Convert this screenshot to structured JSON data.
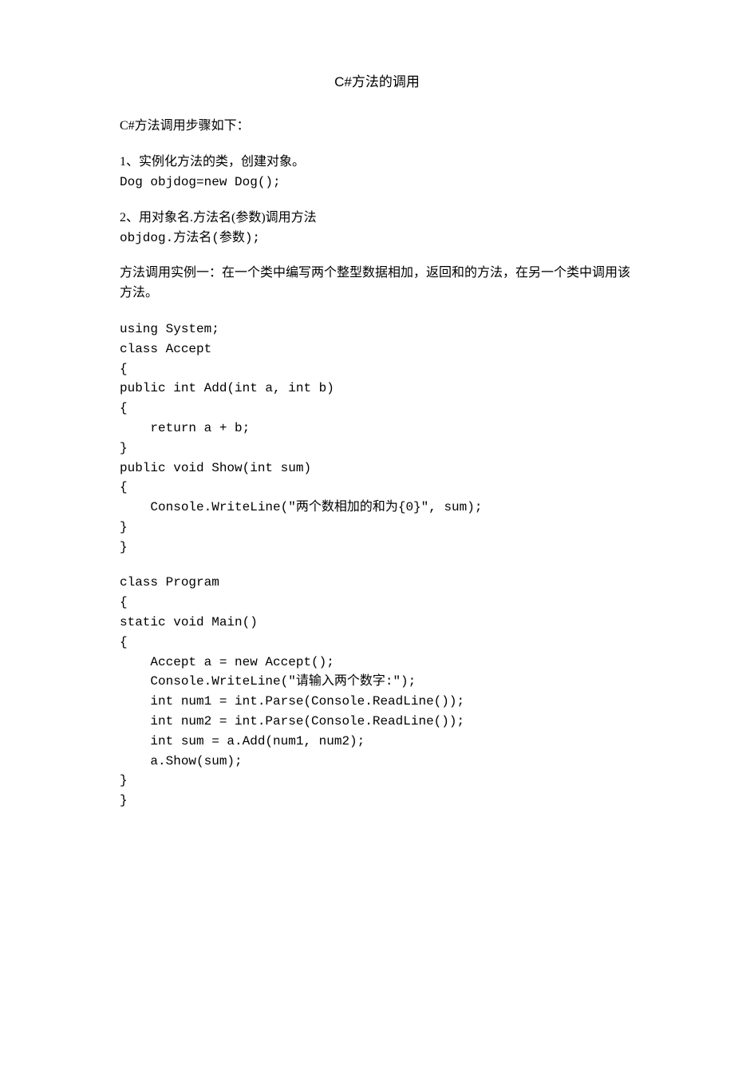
{
  "title": "C#方法的调用",
  "intro": "C#方法调用步骤如下：",
  "step1": {
    "text": "1、实例化方法的类，创建对象。",
    "code": "Dog objdog=new Dog();"
  },
  "step2": {
    "text": "2、用对象名.方法名(参数)调用方法",
    "code": "objdog.方法名(参数);"
  },
  "example_intro": "方法调用实例一：在一个类中编写两个整型数据相加，返回和的方法，在另一个类中调用该方法。",
  "code_block1": {
    "l1": "using System;",
    "l2": "class Accept",
    "l3": "{",
    "l4": "public int Add(int a, int b)",
    "l5": "{",
    "l6": "    return a + b;",
    "l7": "}",
    "l8": "public void Show(int sum)",
    "l9": "{",
    "l10": "    Console.WriteLine(\"两个数相加的和为{0}\", sum);",
    "l11": "}",
    "l12": "}"
  },
  "code_block2": {
    "l1": "class Program",
    "l2": "{",
    "l3": "static void Main()",
    "l4": "{",
    "l5": "    Accept a = new Accept();",
    "l6": "    Console.WriteLine(\"请输入两个数字:\");",
    "l7": "    int num1 = int.Parse(Console.ReadLine());",
    "l8": "    int num2 = int.Parse(Console.ReadLine());",
    "l9": "    int sum = a.Add(num1, num2);",
    "l10": "    a.Show(sum);",
    "l11": "}",
    "l12": "}"
  }
}
